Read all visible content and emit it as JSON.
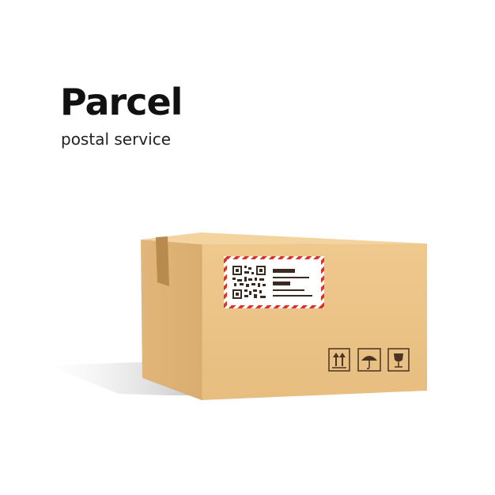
{
  "heading": {
    "title": "Parcel",
    "subtitle": "postal service"
  },
  "box": {
    "color": "#e8bf84",
    "tape_color": "#b98a4e",
    "label_border_colors": [
      "#d9342b",
      "#ffffff"
    ],
    "handling_icons": [
      "this-way-up-icon",
      "keep-dry-icon",
      "fragile-icon"
    ]
  }
}
